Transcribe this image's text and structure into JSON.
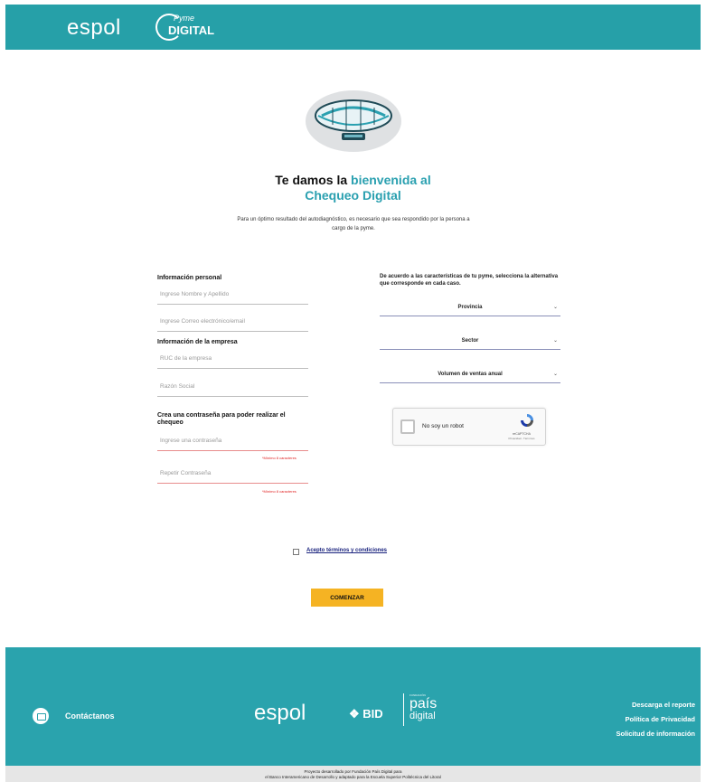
{
  "header": {
    "logo_espol": "espol",
    "logo_digital_script": "Pyme",
    "logo_digital_word": "DIGITAL"
  },
  "hero": {
    "title_prefix": "Te damos la ",
    "title_highlight": "bienvenida al",
    "title_line2": "Chequeo Digital",
    "subtitle": "Para un óptimo resultado del autodiagnóstico, es necesario que sea respondido por la persona a cargo de la pyme."
  },
  "form": {
    "personal_heading": "Información personal",
    "name_placeholder": "Ingrese Nombre y Apellido",
    "email_placeholder": "Ingrese Correo electrónico/email",
    "company_heading": "Información de la empresa",
    "ruc_placeholder": "RUC de la empresa",
    "razon_placeholder": "Razón Social",
    "password_heading": "Crea una contraseña para poder realizar el chequeo",
    "password_placeholder": "Ingrese una contraseña",
    "password_hint": "*Mínimo 8 caracteres",
    "repeat_placeholder": "Repetir Contraseña",
    "repeat_hint": "*Mínimo 8 caracteres",
    "right_text": "De acuerdo a las características de tu pyme, selecciona la alternativa que corresponde en cada caso.",
    "select_provincia": "Provincia",
    "select_sector": "Sector",
    "select_ventas": "Volumen de ventas anual",
    "recaptcha_label": "No soy un robot",
    "recaptcha_brand": "reCAPTCHA",
    "recaptcha_terms": "Privacidad - Términos",
    "terms_label": "Acepto términos y condiciones",
    "submit_label": "COMENZAR"
  },
  "footer": {
    "contact_label": "Contáctanos",
    "logo_espol": "espol",
    "logo_bid": "BID",
    "pais_top": "FUNDACIÓN",
    "pais_big": "país",
    "pais_digital": "digital",
    "links": [
      "Descarga el reporte",
      "Política de Privacidad",
      "Solicitud de información"
    ],
    "credit_line1": "Proyecto desarrollado por Fundación País Digital para",
    "credit_line2": "el Banco Interamericano de Desarrollo y adaptado para la Escuela Superior Politécnica del Litoral"
  },
  "colors": {
    "teal": "#26a0a8",
    "accent_text": "#2aa0b0",
    "button": "#f5b323"
  }
}
